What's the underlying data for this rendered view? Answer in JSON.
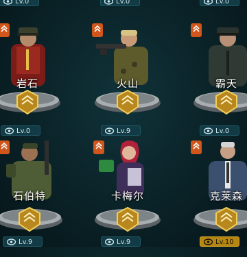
{
  "rows": [
    {
      "top_levels": [
        "Lv.0",
        "Lv.0",
        "Lv.0"
      ],
      "heroes": [
        {
          "name": "岩石",
          "level": "Lv.0",
          "owned": false
        },
        {
          "name": "火山",
          "level": "Lv.9",
          "owned": true
        },
        {
          "name": "霸天",
          "level": "Lv.0",
          "owned": false
        }
      ]
    },
    {
      "heroes": [
        {
          "name": "石伯特",
          "level": "Lv.9",
          "owned": true
        },
        {
          "name": "卡梅尔",
          "level": "Lv.9",
          "owned": true
        },
        {
          "name": "克莱森",
          "level": "Lv.10",
          "owned": true,
          "max": true
        }
      ]
    }
  ],
  "colors": {
    "accent": "#d0561c",
    "gold": "#b58712",
    "pill": "#123b46"
  }
}
